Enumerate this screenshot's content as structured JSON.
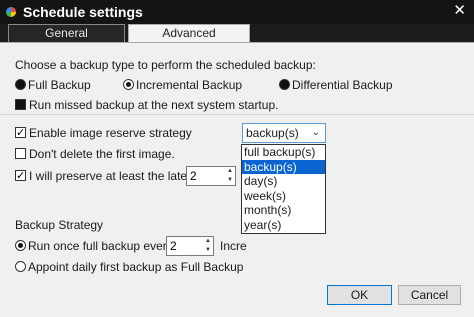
{
  "window": {
    "title": "Schedule settings",
    "close_glyph": "✕"
  },
  "tabs": [
    {
      "label": "General"
    },
    {
      "label": "Advanced"
    }
  ],
  "backup_type": {
    "prompt": "Choose a backup type to perform the scheduled backup:",
    "options": [
      {
        "label": "Full Backup",
        "selected": false
      },
      {
        "label": "Incremental Backup",
        "selected": true
      },
      {
        "label": "Differential Backup",
        "selected": false
      }
    ],
    "run_missed": {
      "label": "Run missed backup at the next system startup.",
      "checked": false
    }
  },
  "image_reserve": {
    "enable": {
      "label": "Enable image reserve strategy",
      "checked": true
    },
    "dont_delete": {
      "label": "Don't delete the first image.",
      "checked": false
    },
    "preserve": {
      "label": "I will preserve at least the latest",
      "checked": true,
      "value": "2"
    },
    "unit_select": {
      "value": "backup(s)",
      "options": [
        "full backup(s)",
        "backup(s)",
        "day(s)",
        "week(s)",
        "month(s)",
        "year(s)"
      ]
    }
  },
  "backup_strategy": {
    "heading": "Backup Strategy",
    "run_once": {
      "label": "Run once full backup every",
      "selected": true,
      "value": "2",
      "suffix": "Incre"
    },
    "appoint": {
      "label": "Appoint daily first backup as Full Backup",
      "selected": false
    }
  },
  "footer": {
    "ok": "OK",
    "cancel": "Cancel"
  },
  "colors": {
    "titlebar": "#141414",
    "accent": "#0a64d2",
    "panel": "#f0f0f0"
  }
}
